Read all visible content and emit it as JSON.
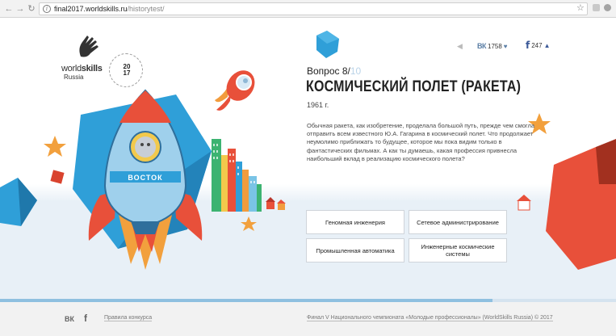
{
  "browser": {
    "url_host": "final2017.worldskills.ru",
    "url_path": "/historytest/"
  },
  "logo": {
    "brand_light": "world",
    "brand_bold": "skills",
    "brand_sub": "Russia",
    "seal_year_top": "20",
    "seal_year_bottom": "17"
  },
  "social": {
    "vk_label": "ВК",
    "vk_count": "1758",
    "fb_label": "f",
    "fb_count": "247"
  },
  "question": {
    "label": "Вопрос 8/",
    "total": "10",
    "title": "КОСМИЧЕСКИЙ ПОЛЕТ (РАКЕТА)",
    "year": "1961 г.",
    "text": "Обычная ракета, как изобретение, проделала большой путь, прежде чем смогла отправить всем известного Ю.А. Гагарина в космический полет. Что продолжает неумолимо приближать то будущее, которое мы пока видим только в фантастических фильмах. А как ты думаешь, какая профессия привнесла наибольший вклад в реализацию космического полета?"
  },
  "answers": [
    "Геномная инженерия",
    "Сетевое администрирование",
    "Промышленная автоматика",
    "Инженерные космические системы"
  ],
  "illustration": {
    "rocket_label": "ВОСТОК"
  },
  "progress": {
    "fraction": 0.8
  },
  "footer": {
    "vk_label": "ВК",
    "fb_label": "f",
    "rules_link": "Правила конкурса",
    "copyright": "Финал V Национального чемпионата «Молодые профессионалы» (WorldSkills Russia) © 2017"
  },
  "colors": {
    "accent_blue": "#2f9fd8",
    "accent_red": "#e8503a",
    "accent_orange": "#f2a03d",
    "vk_blue": "#5c7fa6",
    "fb_blue": "#3b5998"
  }
}
